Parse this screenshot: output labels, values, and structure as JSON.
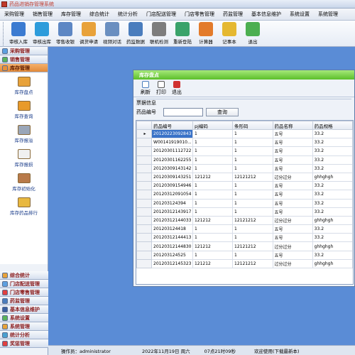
{
  "app": {
    "title": "药品进销存管理系统"
  },
  "menu": [
    "采购管理",
    "销售管理",
    "库存管理",
    "综合统计",
    "统计分析",
    "门店配送管理",
    "门店零售管理",
    "药监管理",
    "基本信息维护",
    "系统设置",
    "系统管理"
  ],
  "toolbar": [
    {
      "label": "审核入库",
      "icon": "inbound-review-icon",
      "color": "#3b7bd1"
    },
    {
      "label": "审核出库",
      "icon": "outbound-review-icon",
      "color": "#2d9cdb"
    },
    {
      "label": "零售收银",
      "icon": "cash-register-icon",
      "color": "#5d87c4"
    },
    {
      "label": "调货申请",
      "icon": "transfer-request-icon",
      "color": "#e8a23a"
    },
    {
      "label": "视频对话",
      "icon": "video-chat-icon",
      "color": "#6a8fc0"
    },
    {
      "label": "药监数据",
      "icon": "drug-data-icon",
      "color": "#4a7dbd"
    },
    {
      "label": "联机检测",
      "icon": "online-check-icon",
      "color": "#7d7d7d"
    },
    {
      "label": "重新登陆",
      "icon": "relogin-icon",
      "color": "#3aa36a"
    },
    {
      "label": "计算器",
      "icon": "calculator-icon",
      "color": "#e37b2b"
    },
    {
      "label": "记事本",
      "icon": "notepad-icon",
      "color": "#e5b830"
    },
    {
      "label": "退出",
      "icon": "exit-icon",
      "color": "#4caf50"
    }
  ],
  "leftnav": {
    "top_headers": [
      {
        "label": "采购管理",
        "color": "#5da0e0"
      },
      {
        "label": "销售管理",
        "color": "#5bb35b"
      },
      {
        "label": "库存管理",
        "color": "#e8903a",
        "active": true
      }
    ],
    "items": [
      {
        "label": "库存盘点",
        "icon": "stock-count-icon",
        "color": "#e8a23a"
      },
      {
        "label": "库存查询",
        "icon": "stock-query-icon",
        "color": "#e89a2a"
      },
      {
        "label": "库存报溢",
        "icon": "stock-overflow-icon",
        "color": "#9aa6b8"
      },
      {
        "label": "库存报损",
        "icon": "stock-loss-icon",
        "color": "#f0f0f0"
      },
      {
        "label": "库存初始化",
        "icon": "stock-init-icon",
        "color": "#b87a4a"
      },
      {
        "label": "库存药品排行",
        "icon": "stock-rank-icon",
        "color": "#e8b840"
      }
    ],
    "bottom_headers": [
      {
        "label": "综合统计",
        "color": "#e8a23a"
      },
      {
        "label": "门店配送管理",
        "color": "#5da0e0"
      },
      {
        "label": "门店零售管理",
        "color": "#e04040"
      },
      {
        "label": "药监管理",
        "color": "#4a7dbd"
      },
      {
        "label": "基本信息维护",
        "color": "#3a5fa0"
      },
      {
        "label": "系统设置",
        "color": "#5bb35b"
      },
      {
        "label": "系统管理",
        "color": "#e8a23a"
      },
      {
        "label": "统计分析",
        "color": "#4aa0d0"
      },
      {
        "label": "奖惩管理",
        "color": "#e04040"
      }
    ]
  },
  "status": {
    "operator": "操作员：administrator",
    "date": "2022年11月19日 周六",
    "time": "07点21时09秒",
    "welcome": "欢迎使用(下载最新本)"
  },
  "window": {
    "title": "库存盘点",
    "buttons": [
      {
        "label": "刷新",
        "icon": "refresh-icon"
      },
      {
        "label": "打印",
        "icon": "print-icon"
      },
      {
        "label": "退出",
        "icon": "exit-icon"
      }
    ],
    "group_label": "票据信息",
    "field_label": "药品编号",
    "field_value": "",
    "query_label": "查询",
    "columns": [
      "药品编号",
      "pj编码",
      "条形码",
      "药品名称",
      "药品规格"
    ],
    "rows": [
      [
        "20120223092843",
        "1",
        "1",
        "五号",
        "33.2"
      ],
      [
        "W00141919010...",
        "1",
        "1",
        "五号",
        "33.2"
      ],
      [
        "20120301112722",
        "1",
        "1",
        "五号",
        "33.2"
      ],
      [
        "20120301162255",
        "1",
        "1",
        "五号",
        "33.2"
      ],
      [
        "20120309143142",
        "1",
        "1",
        "五号",
        "33.2"
      ],
      [
        "20120309143251",
        "121212",
        "12121212",
        "过分过分",
        "ghhghgh"
      ],
      [
        "20120309154946",
        "1",
        "1",
        "五号",
        "33.2"
      ],
      [
        "20120312091054",
        "1",
        "1",
        "五号",
        "33.2"
      ],
      [
        "201203124394",
        "1",
        "1",
        "五号",
        "33.2"
      ],
      [
        "20120312143917",
        "1",
        "1",
        "五号",
        "33.2"
      ],
      [
        "20120312144033",
        "121212",
        "12121212",
        "过分过分",
        "ghhghgh"
      ],
      [
        "201203124418",
        "1",
        "1",
        "五号",
        "33.2"
      ],
      [
        "20120312144413",
        "1",
        "1",
        "五号",
        "33.2"
      ],
      [
        "20120312144830",
        "121212",
        "12121212",
        "过分过分",
        "ghhghgh"
      ],
      [
        "201203124525",
        "1",
        "1",
        "五号",
        "33.2"
      ],
      [
        "20120312145323",
        "121212",
        "12121212",
        "过分过分",
        "ghhghgh"
      ]
    ]
  }
}
